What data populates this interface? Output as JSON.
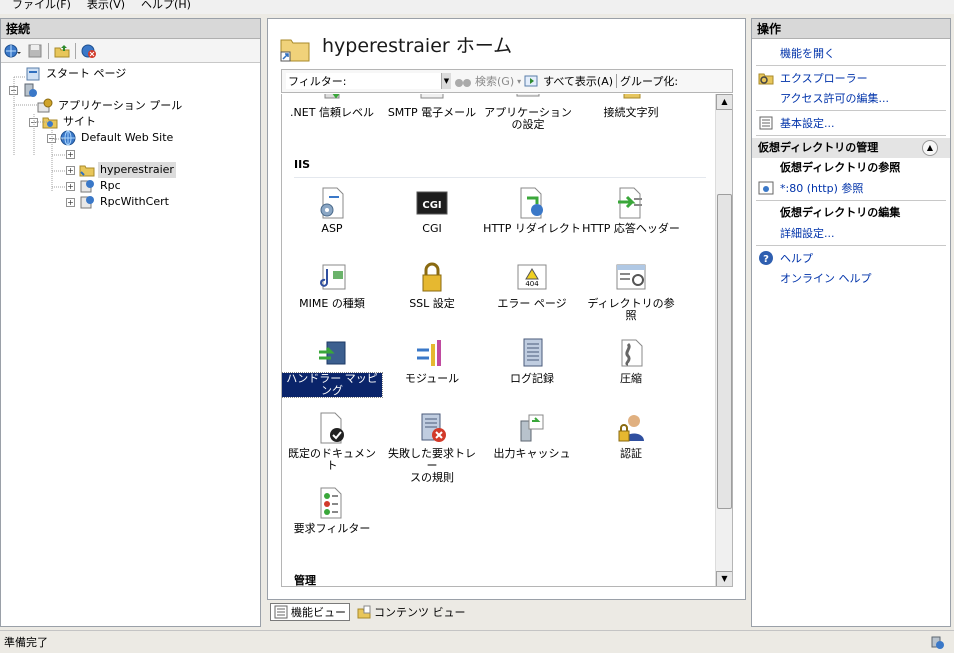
{
  "menu": {
    "file": "ファイル(F)",
    "view": "表示(V)",
    "help": "ヘルプ(H)"
  },
  "connections": {
    "title": "接続",
    "tree": {
      "start_page": "スタート ページ",
      "app_pools": "アプリケーション プール",
      "sites": "サイト",
      "default_web_site": "Default Web Site",
      "hyperestraier": "hyperestraier",
      "rpc": "Rpc",
      "rpc_with_cert": "RpcWithCert"
    }
  },
  "center": {
    "title": "hyperestraier ホーム",
    "filter": {
      "label": "フィルター:",
      "search": "検索(G)",
      "show_all": "すべて表示(A)",
      "group_by": "グループ化:"
    },
    "top_row": [
      ".NET 信頼レベル",
      "SMTP 電子メール",
      "アプリケーションの設定",
      "接続文字列"
    ],
    "group_iis": "IIS",
    "features": {
      "asp": "ASP",
      "cgi": "CGI",
      "cgi_badge": "CGI",
      "http_redirect": "HTTP リダイレクト",
      "http_headers": "HTTP 応答ヘッダー",
      "mime": "MIME の種類",
      "ssl": "SSL 設定",
      "error_pages": "エラー ページ",
      "error_badge": "404",
      "dir_browse": "ディレクトリの参照",
      "handler": "ハンドラー マッピング",
      "modules": "モジュール",
      "logging": "ログ記録",
      "compression": "圧縮",
      "default_doc": "既定のドキュメント",
      "failed_trace_1": "失敗した要求トレー",
      "failed_trace_2": "スの規則",
      "output_cache": "出力キャッシュ",
      "auth": "認証",
      "request_filter": "要求フィルター"
    },
    "group_manage": "管理",
    "view_tabs": {
      "features": "機能ビュー",
      "content": "コンテンツ ビュー"
    }
  },
  "actions": {
    "title": "操作",
    "open_feature": "機能を開く",
    "explorer": "エクスプローラー",
    "edit_perms": "アクセス許可の編集...",
    "basic_settings": "基本設定...",
    "section_vdir": "仮想ディレクトリの管理",
    "browse_vdir": "仮想ディレクトリの参照",
    "browse_80": "*:80 (http) 参照",
    "edit_vdir": "仮想ディレクトリの編集",
    "advanced": "詳細設定...",
    "help": "ヘルプ",
    "online_help": "オンライン ヘルプ"
  },
  "status": {
    "text": "準備完了"
  },
  "colors": {
    "accent_selected": "#0a246a",
    "link": "#0033aa",
    "panel_header": "#d8d8d8"
  }
}
